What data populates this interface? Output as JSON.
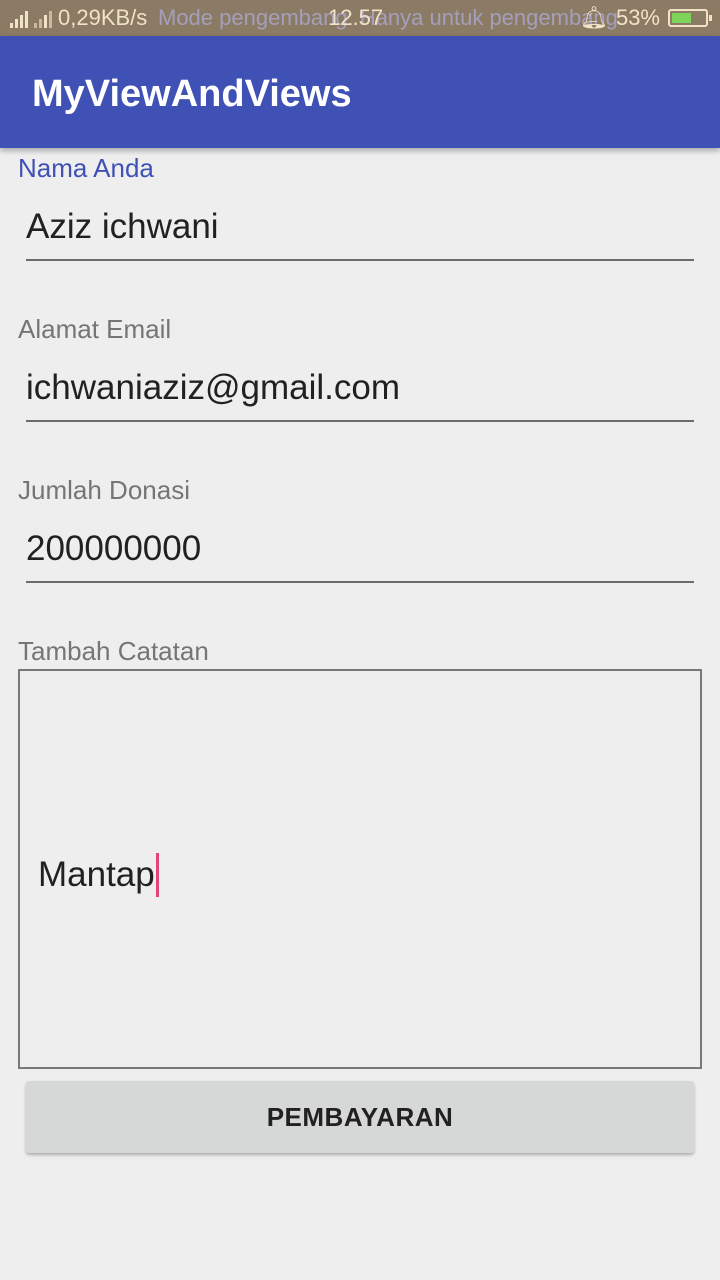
{
  "status_bar": {
    "network_speed": "0,29KB/s",
    "overlay_text": "Mode pengembang: Hanya untuk pengembang",
    "time": "12.57",
    "battery": "53%",
    "battery_level": 0.53
  },
  "app_bar": {
    "title": "MyViewAndViews"
  },
  "form": {
    "name": {
      "label": "Nama Anda",
      "value": "Aziz ichwani"
    },
    "email": {
      "label": "Alamat Email",
      "value": "ichwaniaziz@gmail.com"
    },
    "donation": {
      "label": "Jumlah Donasi",
      "value": "200000000"
    },
    "notes": {
      "label": "Tambah Catatan",
      "value": "Mantap"
    }
  },
  "button": {
    "label": "PEMBAYARAN"
  },
  "colors": {
    "primary": "#3f51b5",
    "accent": "#e0457b",
    "background": "#eeeeee"
  }
}
